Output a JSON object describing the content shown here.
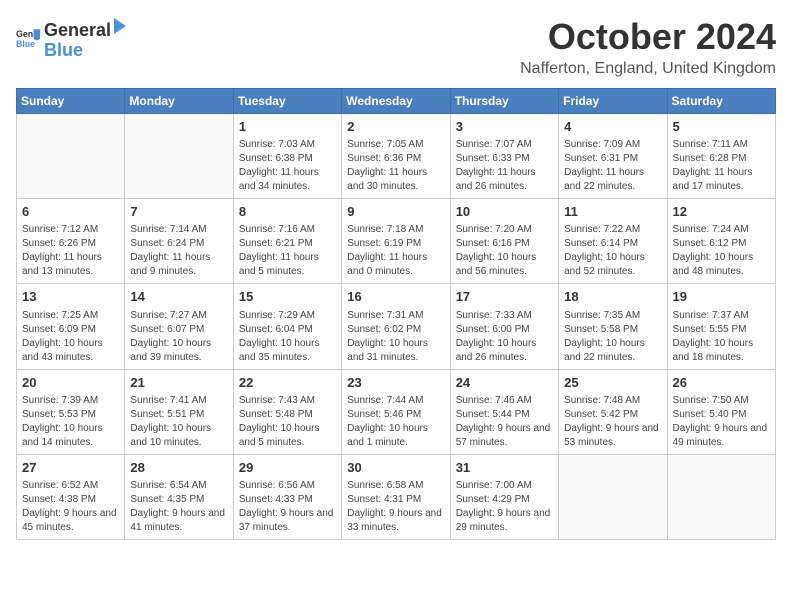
{
  "header": {
    "logo_general": "General",
    "logo_blue": "Blue",
    "month_title": "October 2024",
    "location": "Nafferton, England, United Kingdom"
  },
  "calendar": {
    "days_of_week": [
      "Sunday",
      "Monday",
      "Tuesday",
      "Wednesday",
      "Thursday",
      "Friday",
      "Saturday"
    ],
    "weeks": [
      [
        {
          "day": "",
          "detail": ""
        },
        {
          "day": "",
          "detail": ""
        },
        {
          "day": "1",
          "detail": "Sunrise: 7:03 AM\nSunset: 6:38 PM\nDaylight: 11 hours and 34 minutes."
        },
        {
          "day": "2",
          "detail": "Sunrise: 7:05 AM\nSunset: 6:36 PM\nDaylight: 11 hours and 30 minutes."
        },
        {
          "day": "3",
          "detail": "Sunrise: 7:07 AM\nSunset: 6:33 PM\nDaylight: 11 hours and 26 minutes."
        },
        {
          "day": "4",
          "detail": "Sunrise: 7:09 AM\nSunset: 6:31 PM\nDaylight: 11 hours and 22 minutes."
        },
        {
          "day": "5",
          "detail": "Sunrise: 7:11 AM\nSunset: 6:28 PM\nDaylight: 11 hours and 17 minutes."
        }
      ],
      [
        {
          "day": "6",
          "detail": "Sunrise: 7:12 AM\nSunset: 6:26 PM\nDaylight: 11 hours and 13 minutes."
        },
        {
          "day": "7",
          "detail": "Sunrise: 7:14 AM\nSunset: 6:24 PM\nDaylight: 11 hours and 9 minutes."
        },
        {
          "day": "8",
          "detail": "Sunrise: 7:16 AM\nSunset: 6:21 PM\nDaylight: 11 hours and 5 minutes."
        },
        {
          "day": "9",
          "detail": "Sunrise: 7:18 AM\nSunset: 6:19 PM\nDaylight: 11 hours and 0 minutes."
        },
        {
          "day": "10",
          "detail": "Sunrise: 7:20 AM\nSunset: 6:16 PM\nDaylight: 10 hours and 56 minutes."
        },
        {
          "day": "11",
          "detail": "Sunrise: 7:22 AM\nSunset: 6:14 PM\nDaylight: 10 hours and 52 minutes."
        },
        {
          "day": "12",
          "detail": "Sunrise: 7:24 AM\nSunset: 6:12 PM\nDaylight: 10 hours and 48 minutes."
        }
      ],
      [
        {
          "day": "13",
          "detail": "Sunrise: 7:25 AM\nSunset: 6:09 PM\nDaylight: 10 hours and 43 minutes."
        },
        {
          "day": "14",
          "detail": "Sunrise: 7:27 AM\nSunset: 6:07 PM\nDaylight: 10 hours and 39 minutes."
        },
        {
          "day": "15",
          "detail": "Sunrise: 7:29 AM\nSunset: 6:04 PM\nDaylight: 10 hours and 35 minutes."
        },
        {
          "day": "16",
          "detail": "Sunrise: 7:31 AM\nSunset: 6:02 PM\nDaylight: 10 hours and 31 minutes."
        },
        {
          "day": "17",
          "detail": "Sunrise: 7:33 AM\nSunset: 6:00 PM\nDaylight: 10 hours and 26 minutes."
        },
        {
          "day": "18",
          "detail": "Sunrise: 7:35 AM\nSunset: 5:58 PM\nDaylight: 10 hours and 22 minutes."
        },
        {
          "day": "19",
          "detail": "Sunrise: 7:37 AM\nSunset: 5:55 PM\nDaylight: 10 hours and 18 minutes."
        }
      ],
      [
        {
          "day": "20",
          "detail": "Sunrise: 7:39 AM\nSunset: 5:53 PM\nDaylight: 10 hours and 14 minutes."
        },
        {
          "day": "21",
          "detail": "Sunrise: 7:41 AM\nSunset: 5:51 PM\nDaylight: 10 hours and 10 minutes."
        },
        {
          "day": "22",
          "detail": "Sunrise: 7:43 AM\nSunset: 5:48 PM\nDaylight: 10 hours and 5 minutes."
        },
        {
          "day": "23",
          "detail": "Sunrise: 7:44 AM\nSunset: 5:46 PM\nDaylight: 10 hours and 1 minute."
        },
        {
          "day": "24",
          "detail": "Sunrise: 7:46 AM\nSunset: 5:44 PM\nDaylight: 9 hours and 57 minutes."
        },
        {
          "day": "25",
          "detail": "Sunrise: 7:48 AM\nSunset: 5:42 PM\nDaylight: 9 hours and 53 minutes."
        },
        {
          "day": "26",
          "detail": "Sunrise: 7:50 AM\nSunset: 5:40 PM\nDaylight: 9 hours and 49 minutes."
        }
      ],
      [
        {
          "day": "27",
          "detail": "Sunrise: 6:52 AM\nSunset: 4:38 PM\nDaylight: 9 hours and 45 minutes."
        },
        {
          "day": "28",
          "detail": "Sunrise: 6:54 AM\nSunset: 4:35 PM\nDaylight: 9 hours and 41 minutes."
        },
        {
          "day": "29",
          "detail": "Sunrise: 6:56 AM\nSunset: 4:33 PM\nDaylight: 9 hours and 37 minutes."
        },
        {
          "day": "30",
          "detail": "Sunrise: 6:58 AM\nSunset: 4:31 PM\nDaylight: 9 hours and 33 minutes."
        },
        {
          "day": "31",
          "detail": "Sunrise: 7:00 AM\nSunset: 4:29 PM\nDaylight: 9 hours and 29 minutes."
        },
        {
          "day": "",
          "detail": ""
        },
        {
          "day": "",
          "detail": ""
        }
      ]
    ]
  }
}
